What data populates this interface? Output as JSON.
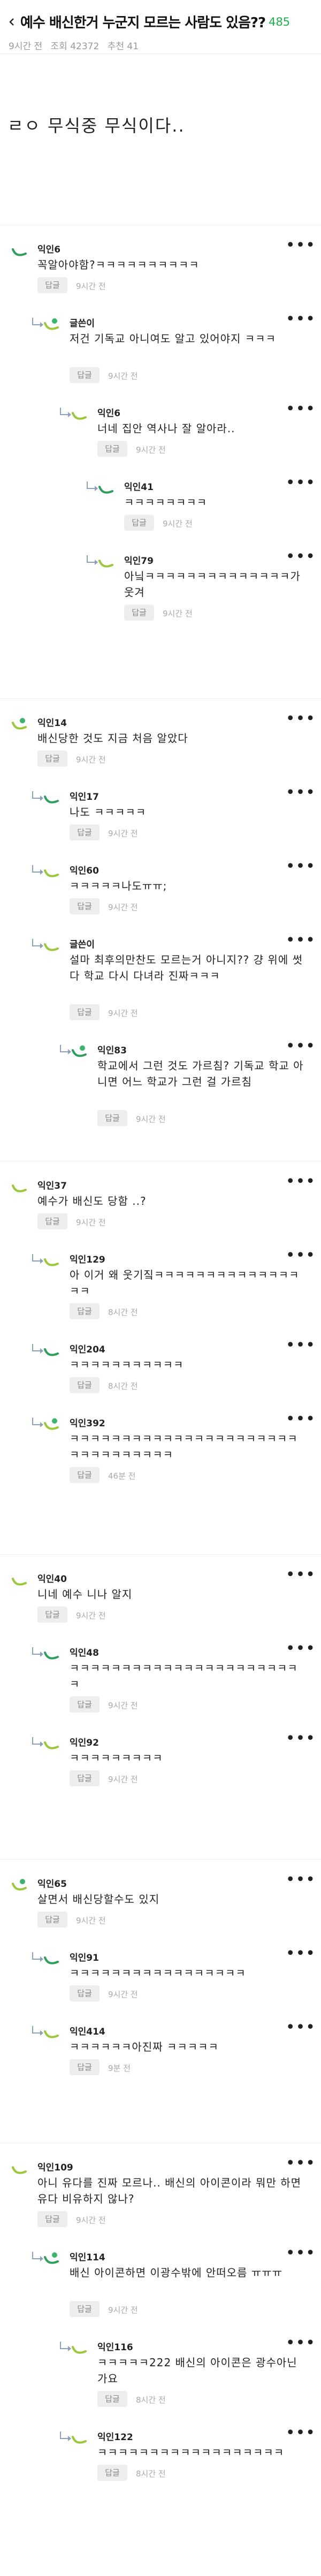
{
  "post": {
    "title": "예수 배신한거 누군지 모르는 사람도 있음??",
    "comment_count": "485",
    "time": "9시간 전",
    "views": "조회 42372",
    "recommend": "추천 41",
    "body": "ㄹㅇ 무식중 무식이다.."
  },
  "ui": {
    "reply_label": "답글",
    "more": "•••"
  },
  "colors": {
    "accent": "#1db24a",
    "reply_bg": "#eeeeee"
  },
  "threads": [
    {
      "root": {
        "nick": "익인6",
        "text": "꼭알아야함?ㅋㅋㅋㅋㅋㅋㅋㅋㅋㅋ",
        "time": "9시간 전"
      },
      "replies": [
        {
          "depth": 1,
          "nick": "글쓴이",
          "text": "저건 기독교 아니여도 알고 있어야지 ㅋㅋㅋ",
          "time": "9시간 전"
        },
        {
          "depth": 2,
          "nick": "익인6",
          "text": "너네 집안 역사나 잘 알아라..",
          "time": "9시간 전"
        },
        {
          "depth": 3,
          "nick": "익인41",
          "text": "ㅋㅋㅋㅋㅋㅋㅋㅋ",
          "time": "9시간 전"
        },
        {
          "depth": 3,
          "nick": "익인79",
          "text": "아닠ㅋㅋㅋㅋㅋㅋㅋㅋㅋㅋㅋㅋㅋㅋ가웃겨",
          "time": "9시간 전"
        }
      ]
    },
    {
      "root": {
        "nick": "익인14",
        "text": "배신당한 것도 지금 처음 알았다",
        "time": "9시간 전"
      },
      "replies": [
        {
          "depth": 1,
          "nick": "익인17",
          "text": "나도 ㅋㅋㅋㅋㅋ",
          "time": "9시간 전"
        },
        {
          "depth": 1,
          "nick": "익인60",
          "text": "ㅋㅋㅋㅋㅋ나도ㅠㅠ;",
          "time": "9시간 전"
        },
        {
          "depth": 1,
          "nick": "글쓴이",
          "text": "설마 최후의만찬도 모르는거 아니지?? 걍 위에 썻다 학교 다시 다녀라 진짜ㅋㅋㅋ",
          "time": "9시간 전"
        },
        {
          "depth": 2,
          "nick": "익인83",
          "text": "학교에서 그런 것도 가르침? 기독교 학교 아니면 어느 학교가 그런 걸 가르침",
          "time": "9시간 전"
        }
      ]
    },
    {
      "root": {
        "nick": "익인37",
        "text": "예수가 배신도 당함 ..?",
        "time": "9시간 전"
      },
      "replies": [
        {
          "depth": 1,
          "nick": "익인129",
          "text": "아 이거 왜 웃기짘ㅋㅋㅋㅋㅋㅋㅋㅋㅋㅋㅋㅋㅋㅋㅋㅋ",
          "time": "8시간 전"
        },
        {
          "depth": 1,
          "nick": "익인204",
          "text": "ㅋㅋㅋㅋㅋㅋㅋㅋㅋㅋㅋ",
          "time": "8시간 전"
        },
        {
          "depth": 1,
          "nick": "익인392",
          "text": "ㅋㅋㅋㅋㅋㅋㅋㅋㅋㅋㅋㅋㅋㅋㅋㅋㅋㅋㅋㅋㅋㅋㅋㅋㅋㅋㅋㅋㅋㅋㅋㅋ",
          "time": "46분 전"
        }
      ]
    },
    {
      "root": {
        "nick": "익인40",
        "text": "니네 예수 니나 알지",
        "time": "9시간 전"
      },
      "replies": [
        {
          "depth": 1,
          "nick": "익인48",
          "text": "ㅋㅋㅋㅋㅋㅋㅋㅋㅋㅋㅋㅋㅋㅋㅋㅋㅋㅋㅋㅋㅋㅋㅋ",
          "time": "9시간 전"
        },
        {
          "depth": 1,
          "nick": "익인92",
          "text": "ㅋㅋㅋㅋㅋㅋㅋㅋㅋ",
          "time": "9시간 전"
        }
      ]
    },
    {
      "root": {
        "nick": "익인65",
        "text": "살면서 배신당할수도 있지",
        "time": "9시간 전"
      },
      "replies": [
        {
          "depth": 1,
          "nick": "익인91",
          "text": "ㅋㅋㅋㅋㅋㅋㅋㅋㅋㅋㅋㅋㅋㅋㅋㅋㅋ",
          "time": "9시간 전"
        },
        {
          "depth": 1,
          "nick": "익인414",
          "text": "ㅋㅋㅋㅋㅋㅋ아진짜 ㅋㅋㅋㅋㅋ",
          "time": "9분 전"
        }
      ]
    },
    {
      "root": {
        "nick": "익인109",
        "text": "아니 유다를 진짜 모르나.. 배신의 아이콘이라 뭐만 하면 유다 비유하지 않나?",
        "time": "9시간 전"
      },
      "replies": [
        {
          "depth": 1,
          "nick": "익인114",
          "text": "배신 아이콘하면 이광수밖에 안떠오름 ㅠㅠㅠ",
          "time": "9시간 전"
        },
        {
          "depth": 2,
          "nick": "익인116",
          "text": "ㅋㅋㅋㅋㅋ222 배신의 아이콘은 광수아닌가요",
          "time": "8시간 전"
        },
        {
          "depth": 2,
          "nick": "익인122",
          "text": "ㅋㅋㅋㅋㅋㅋㅋㅋㅋㅋㅋㅋㅋㅋㅋㅋㅋㅋ",
          "time": "8시간 전"
        }
      ]
    }
  ]
}
